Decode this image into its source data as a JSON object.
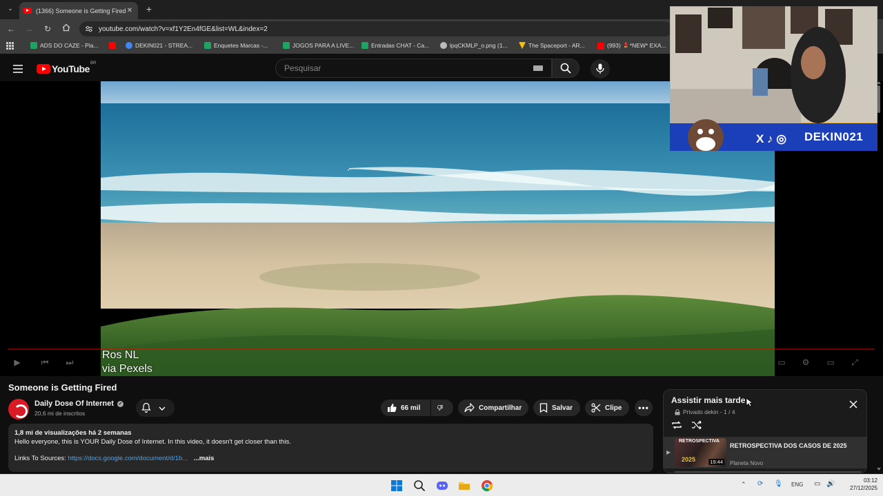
{
  "browser": {
    "tab_title": "(1366) Someone is Getting Fired",
    "url": "youtube.com/watch?v=xf1Y2En4fGE&list=WL&index=2",
    "bookmarks": [
      {
        "label": "ADS DO CAZE - Pla...",
        "color": "#1ea362"
      },
      {
        "label": "",
        "color": "#ff0000"
      },
      {
        "label": "DEKIN021 - STREA...",
        "color": "#4285f4"
      },
      {
        "label": "Enquetes Marcas -...",
        "color": "#1ea362"
      },
      {
        "label": "JOGOS PARA A LIVE...",
        "color": "#1ea362"
      },
      {
        "label": "Entradas CHAT - Ca...",
        "color": "#1ea362"
      },
      {
        "label": "lpqCKMLP_o.png (1...",
        "color": "#bbbbbb"
      },
      {
        "label": "The Spaceport - AR...",
        "color": "#f4c20d"
      },
      {
        "label": "(993) 💄*NEW* EXA...",
        "color": "#ff0000"
      }
    ]
  },
  "youtube": {
    "logo_text": "YouTube",
    "country": "BR",
    "search_placeholder": "Pesquisar"
  },
  "player": {
    "credit_line1": "Ros NL",
    "credit_line2": "via Pexels",
    "progress_fraction": 0.0
  },
  "webcam": {
    "handle": "DEKIN021"
  },
  "video": {
    "title": "Someone is Getting Fired",
    "channel": "Daily Dose Of Internet",
    "subscribers": "20,6 mi de inscritos",
    "likes": "66 mil",
    "share_label": "Compartilhar",
    "save_label": "Salvar",
    "clip_label": "Clipe",
    "description": {
      "stats": "1,8 mi de visualizações  há 2 semanas",
      "line1": "Hello everyone, this is YOUR Daily Dose of Internet. In this video, it doesn't get closer than this.",
      "links_label": "Links To Sources:",
      "link": "https://docs.google.com/document/d/1b...",
      "more": "...mais"
    }
  },
  "playlist": {
    "title": "Assistir mais tarde",
    "meta": "Privado dekin - 1 / 4",
    "items": [
      {
        "title": "RETROSPECTIVA DOS CASOS DE 2025",
        "channel": "Planeta Novo",
        "duration": "19:44",
        "thumb_text": "RETROSPECTIVA",
        "thumb_year": "2025"
      }
    ]
  },
  "taskbar": {
    "language": "ENG",
    "time": "03:12",
    "date": "27/12/2025"
  }
}
